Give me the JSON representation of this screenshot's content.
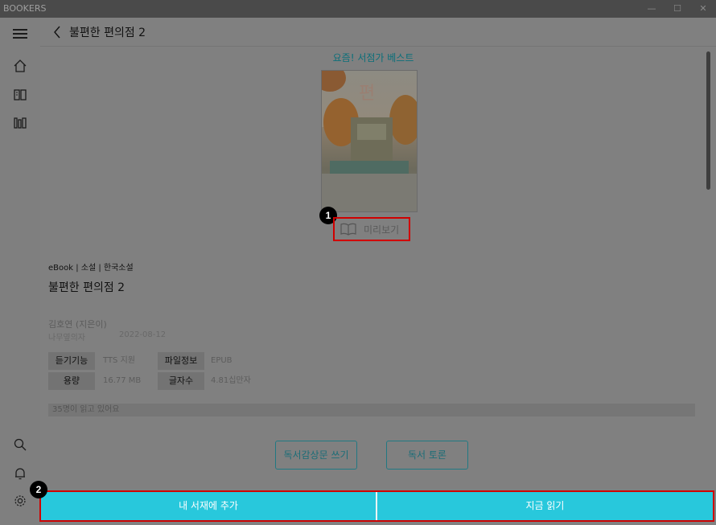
{
  "window": {
    "title": "BOOKERS",
    "controls": [
      "—",
      "☐",
      "✕"
    ]
  },
  "sidebar": {
    "items": [
      {
        "name": "menu",
        "icon": "hamburger-icon"
      },
      {
        "name": "home",
        "icon": "home-icon"
      },
      {
        "name": "library",
        "icon": "book-icon"
      },
      {
        "name": "bookshelf",
        "icon": "bookshelf-icon"
      },
      {
        "name": "search",
        "icon": "search-icon"
      },
      {
        "name": "notifications",
        "icon": "bell-icon"
      },
      {
        "name": "settings",
        "icon": "gear-icon"
      }
    ]
  },
  "header": {
    "back_icon": "chevron-left-icon",
    "title": "불편한 편의점 2"
  },
  "section": {
    "label": "요즘! 서점가 베스트"
  },
  "cover": {
    "title_glyph": "편"
  },
  "preview": {
    "label": "미리보기",
    "badge": "1"
  },
  "book": {
    "category": "eBook | 소설 | 한국소설",
    "title": "불편한 편의점 2",
    "author": "김호연 (지은이)",
    "publisher": "나무옆의자",
    "date": "2022-08-12"
  },
  "info": [
    {
      "key": "듣기기능",
      "value": "TTS 지원"
    },
    {
      "key": "파일정보",
      "value": "EPUB"
    },
    {
      "key": "용량",
      "value": "16.77 MB"
    },
    {
      "key": "글자수",
      "value": "4.81십만자"
    }
  ],
  "readers": {
    "text": "35명이 읽고 있어요"
  },
  "actions": {
    "review": "독서감상문 쓰기",
    "discussion": "독서 토론"
  },
  "bottom": {
    "add_shelf": "내 서재에 추가",
    "read_now": "지금 읽기",
    "badge": "2"
  },
  "colors": {
    "accent": "#28c8dc",
    "highlight": "#d00000",
    "teal_text": "#0b6f7a"
  }
}
